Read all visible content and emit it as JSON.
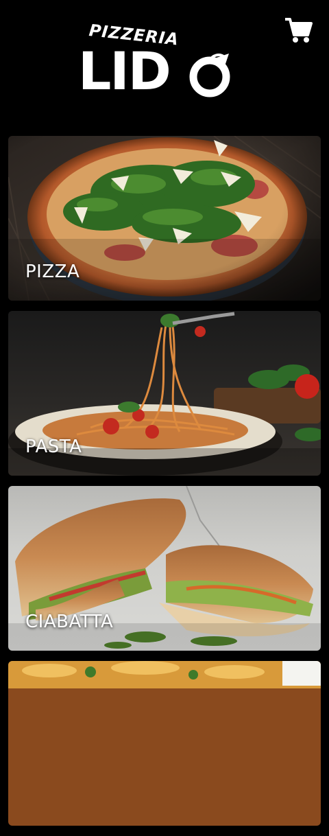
{
  "header": {
    "logo_top": "PIZZERIA",
    "logo_main": "LID",
    "cart_icon": "cart-icon"
  },
  "categories": [
    {
      "label": "PIZZA"
    },
    {
      "label": "PASTA"
    },
    {
      "label": "CIABATTA"
    },
    {
      "label": ""
    }
  ],
  "colors": {
    "background": "#000000",
    "text": "#ffffff"
  }
}
